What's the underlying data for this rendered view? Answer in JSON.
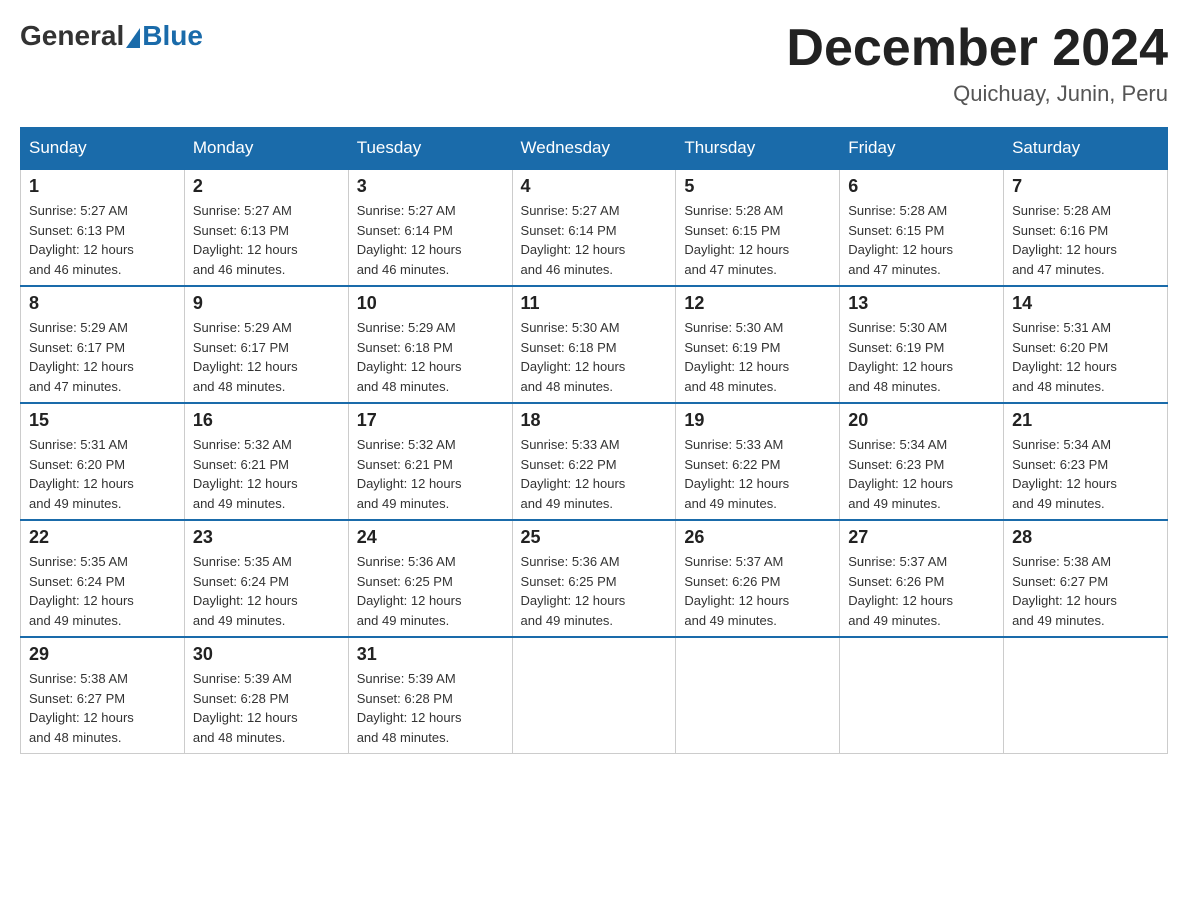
{
  "header": {
    "logo": {
      "general": "General",
      "blue": "Blue"
    },
    "title": "December 2024",
    "location": "Quichuay, Junin, Peru"
  },
  "days_of_week": [
    "Sunday",
    "Monday",
    "Tuesday",
    "Wednesday",
    "Thursday",
    "Friday",
    "Saturday"
  ],
  "weeks": [
    [
      {
        "day": "1",
        "sunrise": "5:27 AM",
        "sunset": "6:13 PM",
        "daylight": "12 hours and 46 minutes."
      },
      {
        "day": "2",
        "sunrise": "5:27 AM",
        "sunset": "6:13 PM",
        "daylight": "12 hours and 46 minutes."
      },
      {
        "day": "3",
        "sunrise": "5:27 AM",
        "sunset": "6:14 PM",
        "daylight": "12 hours and 46 minutes."
      },
      {
        "day": "4",
        "sunrise": "5:27 AM",
        "sunset": "6:14 PM",
        "daylight": "12 hours and 46 minutes."
      },
      {
        "day": "5",
        "sunrise": "5:28 AM",
        "sunset": "6:15 PM",
        "daylight": "12 hours and 47 minutes."
      },
      {
        "day": "6",
        "sunrise": "5:28 AM",
        "sunset": "6:15 PM",
        "daylight": "12 hours and 47 minutes."
      },
      {
        "day": "7",
        "sunrise": "5:28 AM",
        "sunset": "6:16 PM",
        "daylight": "12 hours and 47 minutes."
      }
    ],
    [
      {
        "day": "8",
        "sunrise": "5:29 AM",
        "sunset": "6:17 PM",
        "daylight": "12 hours and 47 minutes."
      },
      {
        "day": "9",
        "sunrise": "5:29 AM",
        "sunset": "6:17 PM",
        "daylight": "12 hours and 48 minutes."
      },
      {
        "day": "10",
        "sunrise": "5:29 AM",
        "sunset": "6:18 PM",
        "daylight": "12 hours and 48 minutes."
      },
      {
        "day": "11",
        "sunrise": "5:30 AM",
        "sunset": "6:18 PM",
        "daylight": "12 hours and 48 minutes."
      },
      {
        "day": "12",
        "sunrise": "5:30 AM",
        "sunset": "6:19 PM",
        "daylight": "12 hours and 48 minutes."
      },
      {
        "day": "13",
        "sunrise": "5:30 AM",
        "sunset": "6:19 PM",
        "daylight": "12 hours and 48 minutes."
      },
      {
        "day": "14",
        "sunrise": "5:31 AM",
        "sunset": "6:20 PM",
        "daylight": "12 hours and 48 minutes."
      }
    ],
    [
      {
        "day": "15",
        "sunrise": "5:31 AM",
        "sunset": "6:20 PM",
        "daylight": "12 hours and 49 minutes."
      },
      {
        "day": "16",
        "sunrise": "5:32 AM",
        "sunset": "6:21 PM",
        "daylight": "12 hours and 49 minutes."
      },
      {
        "day": "17",
        "sunrise": "5:32 AM",
        "sunset": "6:21 PM",
        "daylight": "12 hours and 49 minutes."
      },
      {
        "day": "18",
        "sunrise": "5:33 AM",
        "sunset": "6:22 PM",
        "daylight": "12 hours and 49 minutes."
      },
      {
        "day": "19",
        "sunrise": "5:33 AM",
        "sunset": "6:22 PM",
        "daylight": "12 hours and 49 minutes."
      },
      {
        "day": "20",
        "sunrise": "5:34 AM",
        "sunset": "6:23 PM",
        "daylight": "12 hours and 49 minutes."
      },
      {
        "day": "21",
        "sunrise": "5:34 AM",
        "sunset": "6:23 PM",
        "daylight": "12 hours and 49 minutes."
      }
    ],
    [
      {
        "day": "22",
        "sunrise": "5:35 AM",
        "sunset": "6:24 PM",
        "daylight": "12 hours and 49 minutes."
      },
      {
        "day": "23",
        "sunrise": "5:35 AM",
        "sunset": "6:24 PM",
        "daylight": "12 hours and 49 minutes."
      },
      {
        "day": "24",
        "sunrise": "5:36 AM",
        "sunset": "6:25 PM",
        "daylight": "12 hours and 49 minutes."
      },
      {
        "day": "25",
        "sunrise": "5:36 AM",
        "sunset": "6:25 PM",
        "daylight": "12 hours and 49 minutes."
      },
      {
        "day": "26",
        "sunrise": "5:37 AM",
        "sunset": "6:26 PM",
        "daylight": "12 hours and 49 minutes."
      },
      {
        "day": "27",
        "sunrise": "5:37 AM",
        "sunset": "6:26 PM",
        "daylight": "12 hours and 49 minutes."
      },
      {
        "day": "28",
        "sunrise": "5:38 AM",
        "sunset": "6:27 PM",
        "daylight": "12 hours and 49 minutes."
      }
    ],
    [
      {
        "day": "29",
        "sunrise": "5:38 AM",
        "sunset": "6:27 PM",
        "daylight": "12 hours and 48 minutes."
      },
      {
        "day": "30",
        "sunrise": "5:39 AM",
        "sunset": "6:28 PM",
        "daylight": "12 hours and 48 minutes."
      },
      {
        "day": "31",
        "sunrise": "5:39 AM",
        "sunset": "6:28 PM",
        "daylight": "12 hours and 48 minutes."
      },
      null,
      null,
      null,
      null
    ]
  ],
  "labels": {
    "sunrise_prefix": "Sunrise: ",
    "sunset_prefix": "Sunset: ",
    "daylight_prefix": "Daylight: "
  }
}
